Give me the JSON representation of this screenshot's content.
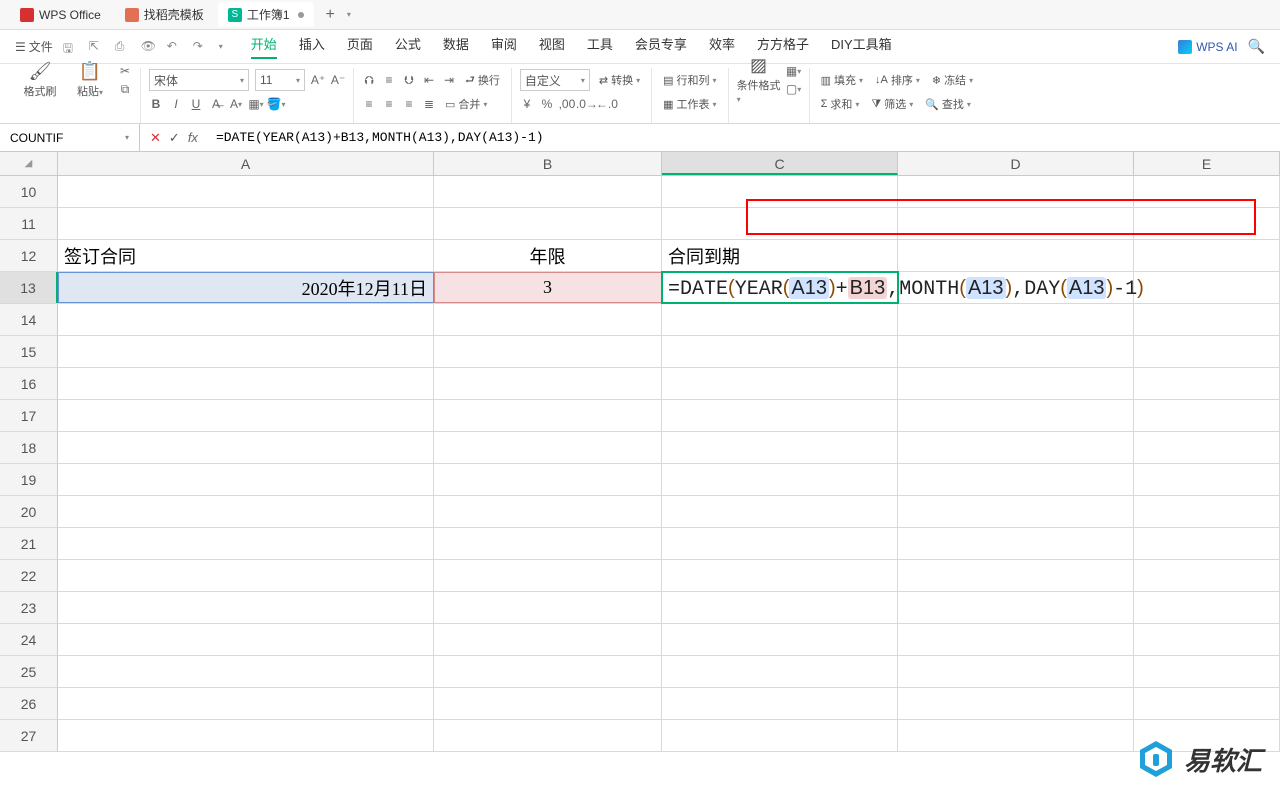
{
  "title_tabs": [
    "WPS Office",
    "找稻壳模板",
    "工作簿1"
  ],
  "menu": {
    "file": "文件",
    "tabs": [
      "开始",
      "插入",
      "页面",
      "公式",
      "数据",
      "审阅",
      "视图",
      "工具",
      "会员专享",
      "效率",
      "方方格子",
      "DIY工具箱"
    ],
    "active": 0,
    "ai": "WPS AI"
  },
  "ribbon": {
    "format_painter": "格式刷",
    "paste": "粘贴",
    "font": "宋体",
    "size": "11",
    "wrap": "换行",
    "merge": "合并",
    "number_format": "自定义",
    "convert": "转换",
    "row_col": "行和列",
    "worksheet": "工作表",
    "cond_format": "条件格式",
    "fill": "填充",
    "sum": "求和",
    "sort": "排序",
    "filter": "筛选",
    "freeze": "冻结",
    "find": "查找"
  },
  "formula_bar": {
    "name": "COUNTIF",
    "formula": "=DATE(YEAR(A13)+B13,MONTH(A13),DAY(A13)-1)"
  },
  "columns": [
    "A",
    "B",
    "C",
    "D",
    "E"
  ],
  "rows": [
    10,
    11,
    12,
    13,
    14,
    15,
    16,
    17,
    18,
    19,
    20,
    21,
    22,
    23,
    24,
    25,
    26,
    27
  ],
  "cells": {
    "A12": "签订合同",
    "B12": "年限",
    "C12": "合同到期",
    "A13": "2020年12月11日",
    "B13": "3"
  },
  "formula_parts": {
    "eq": "=DATE",
    "yp": "YEAR",
    "mp": "MONTH",
    "dp": "DAY",
    "a13": "A13",
    "b13": "B13",
    "plus": "+",
    "comma": ",",
    "minus": "-1",
    "op": "(",
    "cp": ")"
  },
  "watermark": "易软汇"
}
